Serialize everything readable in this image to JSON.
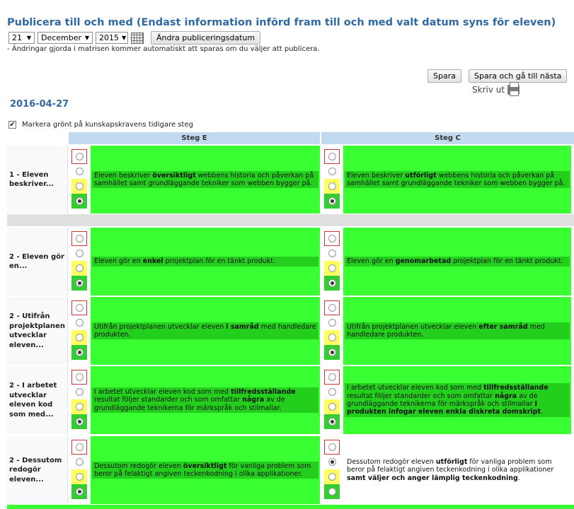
{
  "header": {
    "title": "Publicera till och med (Endast information införd fram till och med valt datum syns för eleven)",
    "day": "21",
    "month": "December",
    "year": "2015",
    "change_date_button": "Ändra publiceringsdatum",
    "note": "- Ändringar gjorda i matrisen kommer automatiskt att sparas om du väljer att publicera."
  },
  "actions": {
    "save": "Spara",
    "save_next": "Spara och gå till nästa",
    "print": "Skriv ut"
  },
  "date_heading": "2016-04-27",
  "mark_green_label": "Markera grönt på kunskapskravens tidigare steg",
  "columns": [
    "Steg E",
    "Steg C"
  ],
  "rows": [
    {
      "label": "1 - Eleven beskriver...",
      "e": [
        "Eleven beskriver ",
        "översiktligt",
        " webbens historia och påverkan på samhället samt grundläggande tekniker som webben bygger på."
      ],
      "c": [
        "Eleven beskriver ",
        "utförligt",
        " webbens historia och påverkan på samhället samt grundläggande tekniker som webben bygger på."
      ]
    },
    {
      "label": "2 - Eleven gör en...",
      "e": [
        "Eleven gör en ",
        "enkel",
        " projektplan för en tänkt produkt."
      ],
      "c": [
        "Eleven gör en ",
        "genomarbetad",
        " projektplan för en tänkt produkt."
      ]
    },
    {
      "label": "2 - Utifrån projektplanen utvecklar eleven...",
      "e": [
        "Utifrån projektplanen utvecklar eleven ",
        "i samråd",
        " med handledare produkten."
      ],
      "c": [
        "Utifrån projektplanen utvecklar eleven ",
        "efter samråd",
        " med handledare produkten."
      ]
    },
    {
      "label": "2 - I arbetet utvecklar eleven kod som med...",
      "e": [
        "I arbetet utvecklar eleven kod som med ",
        "tillfredsställande",
        " resultat följer standarder och som omfattar ",
        "några",
        " av de grundläggande teknikerna för märkspråk och stilmallar."
      ],
      "c": [
        "I arbetet utvecklar eleven kod som med ",
        "tillfredsställande",
        " resultat följer standarder och som omfattar ",
        "några",
        " av de grundläggande teknikerna för märkspråk och stilmallar ",
        "I produkten infogar eleven enkla diskreta domskript",
        "."
      ]
    },
    {
      "label": "2 - Dessutom redogör eleven...",
      "e": [
        "Dessutom redogör eleven ",
        "översiktligt",
        " för vanliga problem som beror på felaktigt angiven teckenkodning i olika applikationer."
      ],
      "c": [
        "Dessutom redogör eleven ",
        "utförligt",
        " för vanliga problem som beror på felaktigt angiven teckenkodning i olika applikationer ",
        "samt väljer och anger lämplig teckenkodning",
        "."
      ]
    }
  ]
}
